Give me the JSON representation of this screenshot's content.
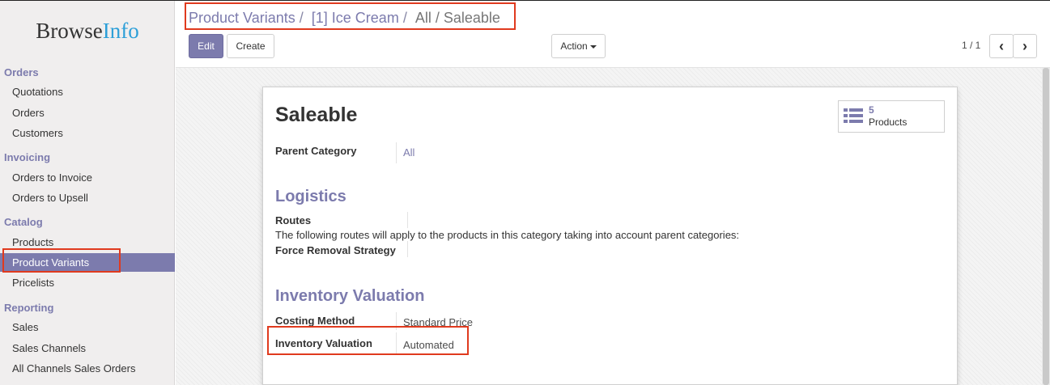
{
  "logo": {
    "part1": "Browse",
    "part2": "Info"
  },
  "sidebar": {
    "sections": [
      {
        "title": "Orders",
        "items": [
          "Quotations",
          "Orders",
          "Customers"
        ]
      },
      {
        "title": "Invoicing",
        "items": [
          "Orders to Invoice",
          "Orders to Upsell"
        ]
      },
      {
        "title": "Catalog",
        "items": [
          "Products",
          "Product Variants",
          "Pricelists"
        ]
      },
      {
        "title": "Reporting",
        "items": [
          "Sales",
          "Sales Channels",
          "All Channels Sales Orders"
        ]
      }
    ],
    "active_item": "Product Variants"
  },
  "breadcrumb": {
    "crumb1": "Product Variants",
    "sep1": "/",
    "crumb2": "[1] Ice Cream",
    "sep2": "/",
    "current": "All / Saleable"
  },
  "toolbar": {
    "edit_label": "Edit",
    "create_label": "Create",
    "action_label": "Action",
    "pager": "1 / 1",
    "prev_icon": "‹",
    "next_icon": "›"
  },
  "form": {
    "title": "Saleable",
    "stat": {
      "count": "5",
      "label": "Products",
      "icon": "list-icon"
    },
    "parent_category_label": "Parent Category",
    "parent_category_value": "All",
    "logistics_heading": "Logistics",
    "routes_label": "Routes",
    "routes_note": "The following routes will apply to the products in this category taking into account parent categories:",
    "force_removal_label": "Force Removal Strategy",
    "inventory_heading": "Inventory Valuation",
    "costing_method_label": "Costing Method",
    "costing_method_value": "Standard Price",
    "inventory_valuation_label": "Inventory Valuation",
    "inventory_valuation_value": "Automated"
  },
  "colors": {
    "accent": "#7c7bad",
    "highlight": "#e03a1e",
    "logo_accent": "#2d9fd8"
  }
}
